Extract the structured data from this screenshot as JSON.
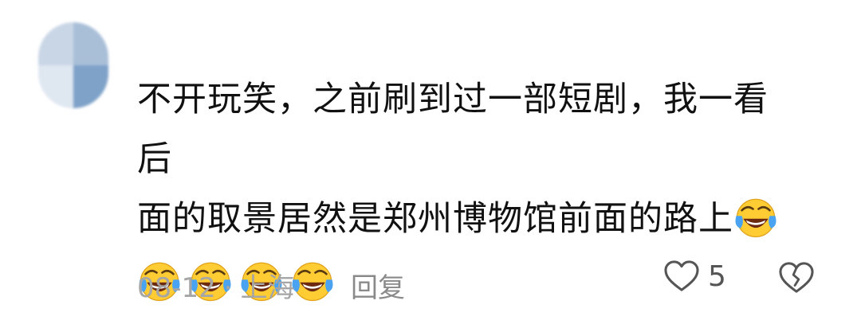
{
  "comment": {
    "text_line1": "不开玩笑，之前刷到过一部短剧，我一看后",
    "text_line2": "面的取景居然是郑州博物馆前面的路上",
    "emojis": [
      "laugh-cry-emoji",
      "laugh-cry-emoji",
      "laugh-cry-emoji",
      "laugh-cry-emoji",
      "laugh-cry-emoji"
    ],
    "date": "08-12",
    "separator": "·",
    "location": "上海",
    "reply_label": "回复",
    "like_count": "5"
  },
  "icons": {
    "like": "heart-outline-icon",
    "dislike": "broken-heart-icon"
  },
  "colors": {
    "text": "#111111",
    "meta": "#a6a6a6",
    "emoji_face": "#ffcc33",
    "emoji_tear": "#4aa3f0"
  }
}
